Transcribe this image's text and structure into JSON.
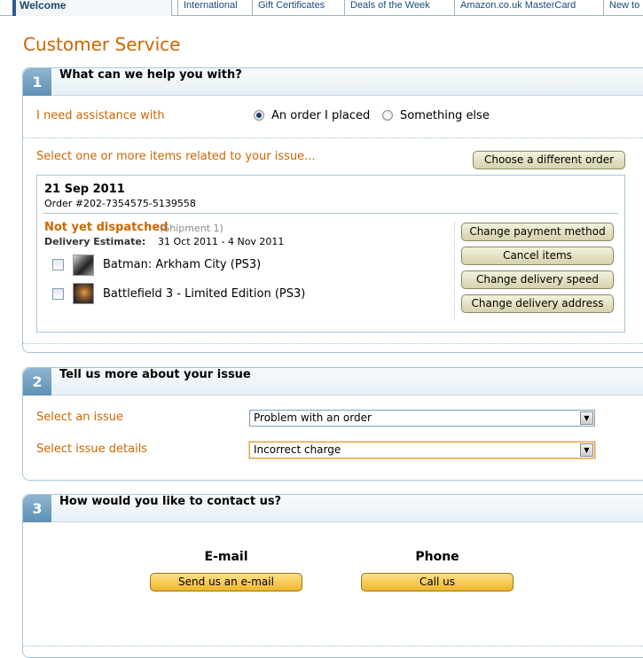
{
  "nav": {
    "welcome": "Welcome",
    "tabs": [
      "International",
      "Gift Certificates",
      "Deals of the Week",
      "Amazon.co.uk MasterCard",
      "New to"
    ]
  },
  "page_title": "Customer Service",
  "section1": {
    "num": "1",
    "title": "What can we help you with?",
    "assist_label": "I need assistance with",
    "radio_order": "An order I placed",
    "radio_else": "Something else",
    "select_items_label": "Select one or more items related to your issue...",
    "choose_diff_order": "Choose a different order",
    "order": {
      "date": "21 Sep 2011",
      "number": "Order #202-7354575-5139558",
      "status": "Not yet dispatched",
      "shipment": "(Shipment 1)",
      "delivery_label": "Delivery Estimate:",
      "delivery_value": "31 Oct 2011 - 4 Nov 2011",
      "items": [
        {
          "name": "Batman: Arkham City (PS3)"
        },
        {
          "name": "Battlefield 3 - Limited Edition (PS3)"
        }
      ],
      "actions": [
        "Change payment method",
        "Cancel items",
        "Change delivery speed",
        "Change delivery address"
      ]
    }
  },
  "section2": {
    "num": "2",
    "title": "Tell us more about your issue",
    "issue_label": "Select an issue",
    "issue_value": "Problem with an order",
    "details_label": "Select issue details",
    "details_value": "Incorrect charge"
  },
  "section3": {
    "num": "3",
    "title": "How would you like to contact us?",
    "email_heading": "E-mail",
    "email_button": "Send us an e-mail",
    "phone_heading": "Phone",
    "phone_button": "Call us"
  },
  "colors": {
    "accent_orange": "#cc6600",
    "section_blue": "#5d8fb6",
    "button_yellow": "#f0b52a"
  }
}
